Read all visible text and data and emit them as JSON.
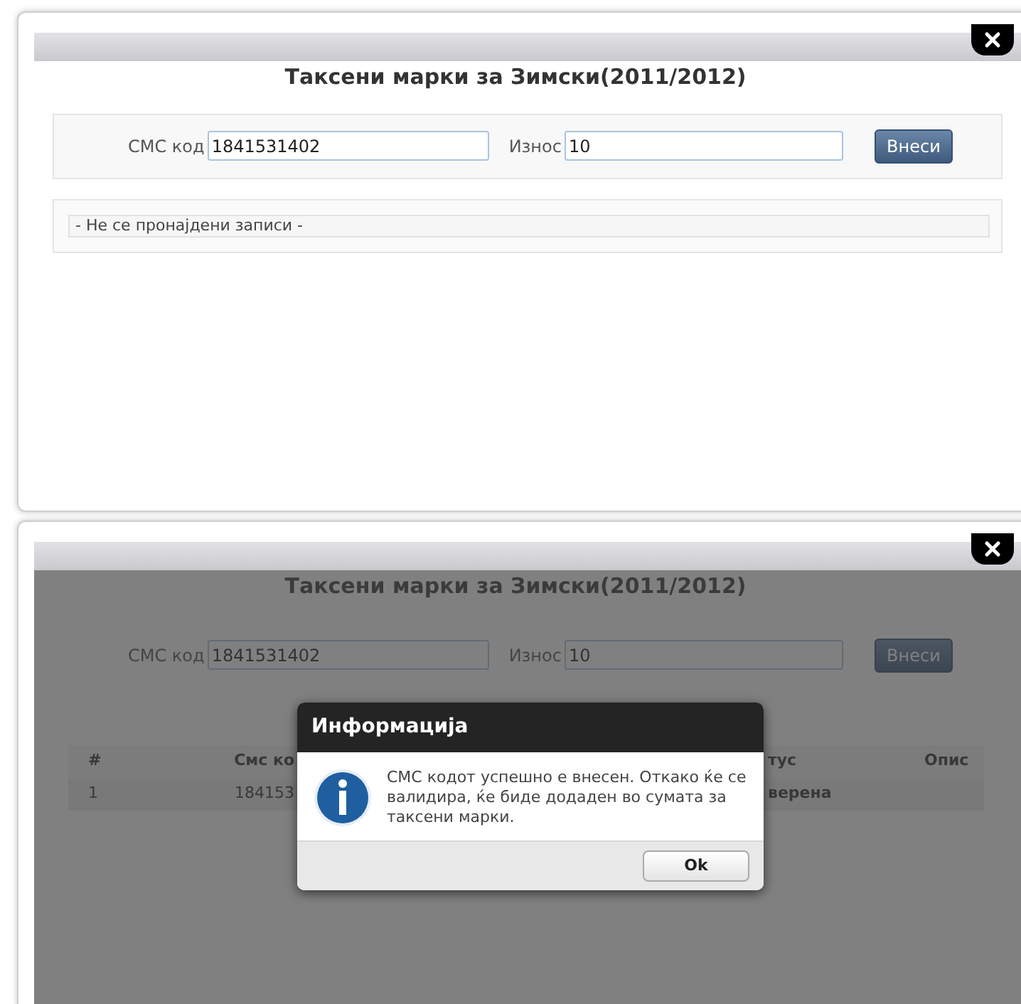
{
  "views": [
    {
      "title": "Таксени марки за Зимски(2011/2012)",
      "overlay": false,
      "sms_label": "СМС код",
      "sms_value": "1841531402",
      "amount_label": "Износ",
      "amount_value": "10",
      "submit_button": "Внеси",
      "empty_message": "- Не се пронајдени записи -"
    },
    {
      "title": "Таксени марки за Зимски(2011/2012)",
      "overlay": true,
      "sms_label": "СМС код",
      "sms_value": "1841531402",
      "amount_label": "Износ",
      "amount_value": "10",
      "submit_button": "Внеси",
      "table": {
        "columns": [
          "#",
          "Смс ко",
          "тус",
          "Опис"
        ],
        "rows": [
          [
            "1",
            "184153",
            "верена",
            ""
          ]
        ]
      },
      "dialog": {
        "title": "Информација",
        "message": "СМС кодот успешно е внесен. Откако ќе се валидира, ќе биде додаден во сумата за таксени марки.",
        "ok_button": "Ok"
      }
    }
  ]
}
